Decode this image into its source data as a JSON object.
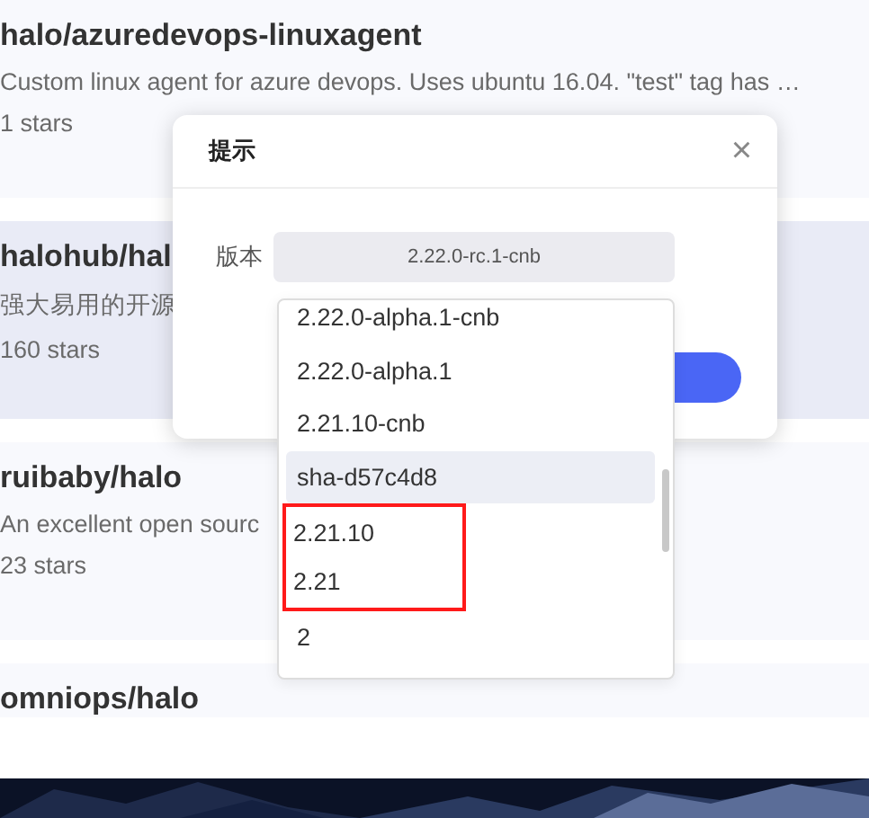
{
  "repos": [
    {
      "name": "halo/azuredevops-linuxagent",
      "description": "Custom linux agent for azure devops. Uses ubuntu 16.04. \"test\" tag has …",
      "stars": "1 stars",
      "hovered": false
    },
    {
      "name": "halohub/hal",
      "description": "强大易用的开源",
      "stars": "160 stars",
      "hovered": true
    },
    {
      "name": "ruibaby/halo",
      "description": "An excellent open sourc",
      "stars": "23 stars",
      "hovered": false
    },
    {
      "name": "omniops/halo",
      "hovered": false
    }
  ],
  "dialog": {
    "title": "提示",
    "close": "×",
    "version_label": "版本",
    "version_value": "2.22.0-rc.1-cnb"
  },
  "dropdown": {
    "options": [
      {
        "label": "2.22.0-alpha.1-cnb",
        "selected": false,
        "boxed": false
      },
      {
        "label": "2.22.0-alpha.1",
        "selected": false,
        "boxed": false
      },
      {
        "label": "2.21.10-cnb",
        "selected": false,
        "boxed": false
      },
      {
        "label": "sha-d57c4d8",
        "selected": true,
        "boxed": false
      },
      {
        "label": "2.21.10",
        "selected": false,
        "boxed": true
      },
      {
        "label": "2.21",
        "selected": false,
        "boxed": true
      },
      {
        "label": "2",
        "selected": false,
        "boxed": false
      }
    ]
  }
}
